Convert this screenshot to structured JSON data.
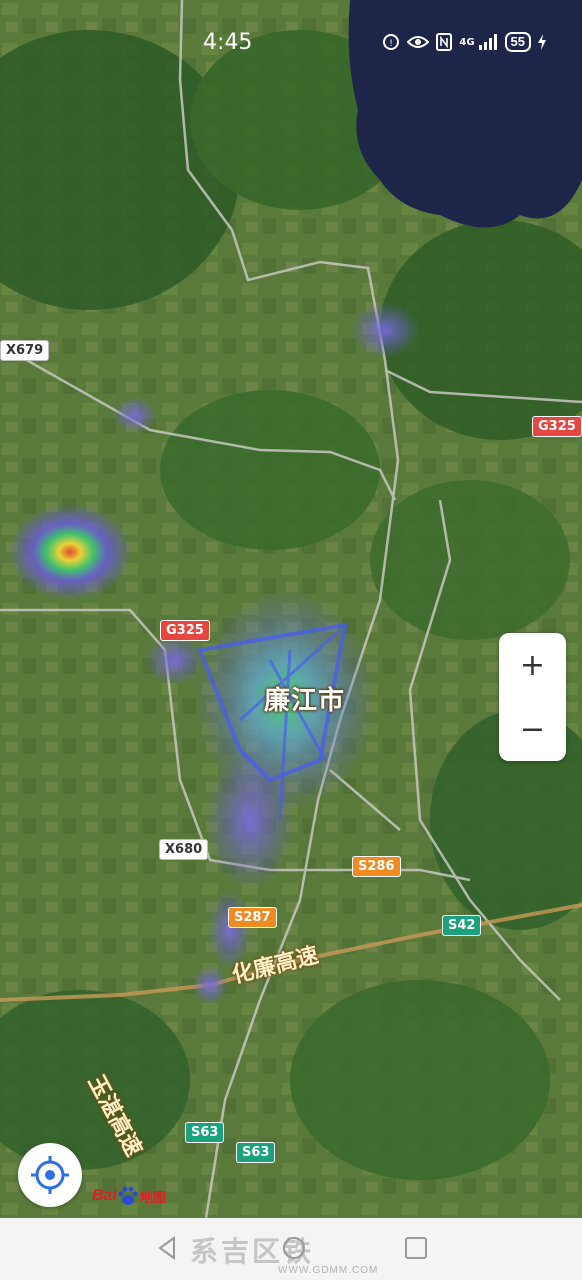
{
  "status_bar": {
    "time": "4:45",
    "network": "4G",
    "battery": "55"
  },
  "map": {
    "type": "satellite-heatmap",
    "city_label": "廉江市",
    "road_labels": [
      {
        "id": "x679",
        "text": "X679",
        "style": "white"
      },
      {
        "id": "g325-east",
        "text": "G325",
        "style": "red"
      },
      {
        "id": "g325-center",
        "text": "G325",
        "style": "red"
      },
      {
        "id": "x680",
        "text": "X680",
        "style": "white"
      },
      {
        "id": "s286",
        "text": "S286",
        "style": "orange"
      },
      {
        "id": "s287",
        "text": "S287",
        "style": "orange"
      },
      {
        "id": "s42",
        "text": "S42",
        "style": "green"
      },
      {
        "id": "s63-a",
        "text": "S63",
        "style": "green"
      },
      {
        "id": "s63-b",
        "text": "S63",
        "style": "green"
      }
    ],
    "expressways": [
      {
        "id": "hualian",
        "text": "化廉高速"
      },
      {
        "id": "yuzhan",
        "text": "玉湛高速"
      }
    ],
    "colors": {
      "heat_low": "#6a5cd8",
      "heat_mid": "#3fc26a",
      "heat_high": "#e8d23a",
      "heat_peak": "#e04a2a",
      "lake": "#1d2648"
    }
  },
  "controls": {
    "zoom_in": "+",
    "zoom_out": "−",
    "locate_icon": "locate-icon"
  },
  "branding": {
    "logo_text": "Bai",
    "logo_tail": "地图"
  },
  "nav_bar": {
    "watermark": "系吉区铁",
    "watermark_url": "WWW.GDMM.COM"
  }
}
